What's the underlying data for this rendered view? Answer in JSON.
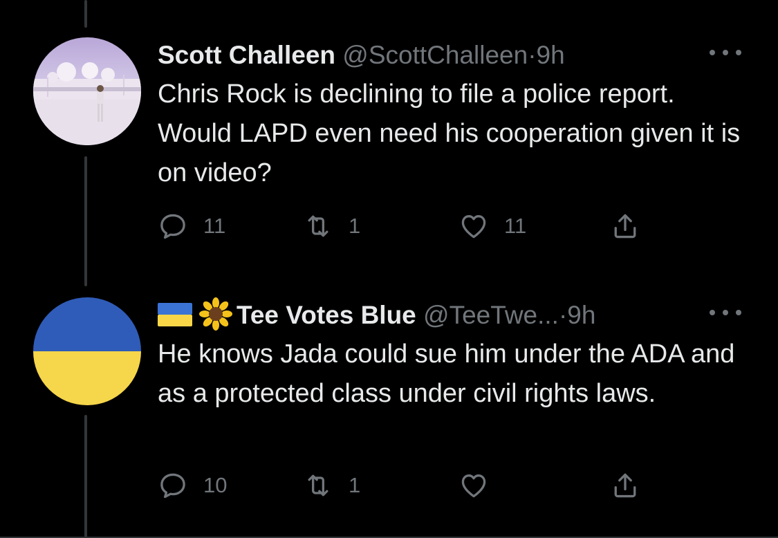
{
  "tweets": [
    {
      "name": "Scott Challeen",
      "handle": "@ScottChalleen",
      "separator": "·",
      "time": "9h",
      "text": "Chris Rock is declining to file a police report. Would LAPD even need his cooperation given it is on video?",
      "replies": "11",
      "retweets": "1",
      "likes": "11"
    },
    {
      "name": "Tee Votes Blue",
      "handle": "@TeeTwe...",
      "separator": "·",
      "time": "9h",
      "text": "He knows Jada could sue him under the ADA and as a protected class under civil rights laws.",
      "replies": "10",
      "retweets": "1",
      "likes": ""
    }
  ],
  "icons": {
    "reply": "reply-icon",
    "retweet": "retweet-icon",
    "like": "heart-icon",
    "share": "share-icon",
    "more": "more-icon"
  },
  "colors": {
    "background": "#000000",
    "text": "#e7e9ea",
    "muted": "#71767b",
    "ukraine_blue": "#2f5cb8",
    "ukraine_yellow": "#f6d64a"
  }
}
